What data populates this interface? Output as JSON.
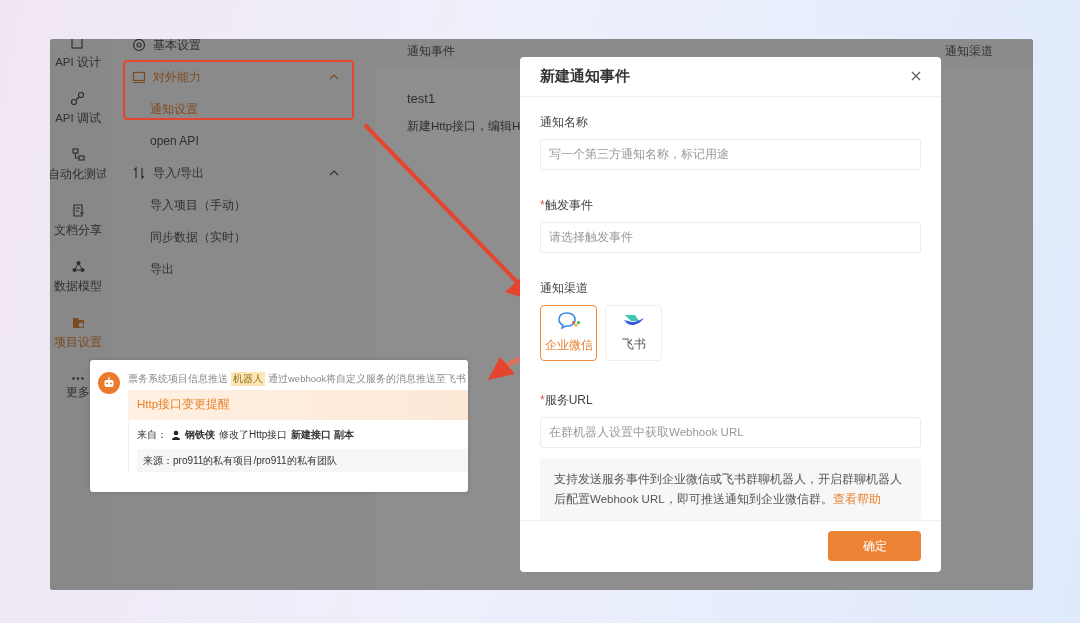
{
  "rail": [
    {
      "label": "API 设计",
      "selected": false
    },
    {
      "label": "API 调试",
      "selected": false
    },
    {
      "label": "自动化测试",
      "selected": false
    },
    {
      "label": "文档分享",
      "selected": false
    },
    {
      "label": "数据模型",
      "selected": false
    },
    {
      "label": "项目设置",
      "selected": true
    },
    {
      "label": "更多",
      "selected": false
    }
  ],
  "settings_menu": [
    {
      "label": "基本设置",
      "selected": false
    },
    {
      "label": "对外能力",
      "selected": true,
      "expanded": true,
      "children": [
        {
          "label": "通知设置",
          "selected": true
        },
        {
          "label": "open API",
          "selected": false
        }
      ]
    },
    {
      "label": "导入/导出",
      "selected": false,
      "expanded": true,
      "children": [
        {
          "label": "导入项目（手动）",
          "selected": false
        },
        {
          "label": "同步数据（实时）",
          "selected": false
        },
        {
          "label": "导出",
          "selected": false
        }
      ]
    }
  ],
  "table": {
    "columns": [
      "通知事件",
      "通知渠道"
    ],
    "rows": [
      {
        "name": "test1",
        "description": "新建Http接口，编辑H"
      }
    ]
  },
  "modal": {
    "title": "新建通知事件",
    "required_marker": "*",
    "fields": [
      {
        "kind": "input",
        "label": "通知名称",
        "required": false,
        "placeholder": "写一个第三方通知名称，标记用途"
      },
      {
        "kind": "input",
        "label": "触发事件",
        "required": true,
        "placeholder": "请选择触发事件"
      },
      {
        "kind": "channels",
        "label": "通知渠道",
        "options": [
          {
            "label": "企业微信",
            "selected": true
          },
          {
            "label": "飞书",
            "selected": false
          }
        ]
      },
      {
        "kind": "input",
        "label": "服务URL",
        "required": true,
        "placeholder": "在群机器人设置中获取Webhook URL"
      }
    ],
    "help": {
      "text": "支持发送服务事件到企业微信或飞书群聊机器人，开启群聊机器人后配置Webhook URL，即可推送通知到企业微信群。",
      "link": "查看帮助"
    },
    "confirm": "确定"
  },
  "message": {
    "sender": "票务系统项目信息推送",
    "tag": "机器人",
    "description": "通过webhook将自定义服务的消息推送至飞书",
    "title": "Http接口变更提醒",
    "from_label": "来自：",
    "user": "钢铁侠",
    "action": "修改了Http接口",
    "target": "新建接口 副本",
    "source": "来源：pro911的私有项目/pro911的私有团队"
  }
}
